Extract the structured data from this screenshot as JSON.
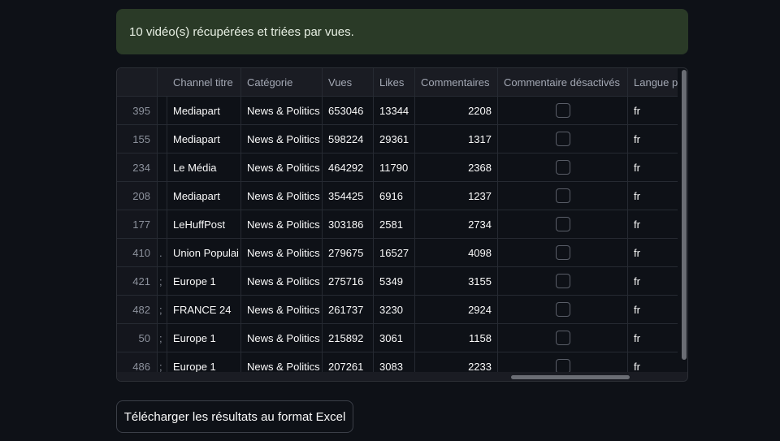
{
  "alert": {
    "message": "10 vidéo(s) récupérées et triées par vues."
  },
  "table": {
    "columns": [
      "",
      "",
      "Channel titre",
      "Catégorie",
      "Vues",
      "Likes",
      "Commentaires",
      "Commentaire désactivés",
      "Langue p"
    ],
    "rows": [
      {
        "index": "395",
        "extra": "",
        "channel": "Mediapart",
        "category": "News & Politics",
        "views": "653046",
        "likes": "13344",
        "comments": "2208",
        "comments_disabled": false,
        "lang": "fr"
      },
      {
        "index": "155",
        "extra": "",
        "channel": "Mediapart",
        "category": "News & Politics",
        "views": "598224",
        "likes": "29361",
        "comments": "1317",
        "comments_disabled": false,
        "lang": "fr"
      },
      {
        "index": "234",
        "extra": "",
        "channel": "Le Média",
        "category": "News & Politics",
        "views": "464292",
        "likes": "11790",
        "comments": "2368",
        "comments_disabled": false,
        "lang": "fr"
      },
      {
        "index": "208",
        "extra": "",
        "channel": "Mediapart",
        "category": "News & Politics",
        "views": "354425",
        "likes": "6916",
        "comments": "1237",
        "comments_disabled": false,
        "lang": "fr"
      },
      {
        "index": "177",
        "extra": "",
        "channel": "LeHuffPost",
        "category": "News & Politics",
        "views": "303186",
        "likes": "2581",
        "comments": "2734",
        "comments_disabled": false,
        "lang": "fr"
      },
      {
        "index": "410",
        "extra": ".",
        "channel": "Union Populai",
        "category": "News & Politics",
        "views": "279675",
        "likes": "16527",
        "comments": "4098",
        "comments_disabled": false,
        "lang": "fr"
      },
      {
        "index": "421",
        "extra": ";",
        "channel": "Europe 1",
        "category": "News & Politics",
        "views": "275716",
        "likes": "5349",
        "comments": "3155",
        "comments_disabled": false,
        "lang": "fr"
      },
      {
        "index": "482",
        "extra": ";",
        "channel": "FRANCE 24",
        "category": "News & Politics",
        "views": "261737",
        "likes": "3230",
        "comments": "2924",
        "comments_disabled": false,
        "lang": "fr"
      },
      {
        "index": "50",
        "extra": ";",
        "channel": "Europe 1",
        "category": "News & Politics",
        "views": "215892",
        "likes": "3061",
        "comments": "1158",
        "comments_disabled": false,
        "lang": "fr"
      },
      {
        "index": "486",
        "extra": ";",
        "channel": "Europe 1",
        "category": "News & Politics",
        "views": "207261",
        "likes": "3083",
        "comments": "2233",
        "comments_disabled": false,
        "lang": "fr"
      }
    ]
  },
  "download_button": {
    "label": "Télécharger les résultats au format Excel"
  }
}
